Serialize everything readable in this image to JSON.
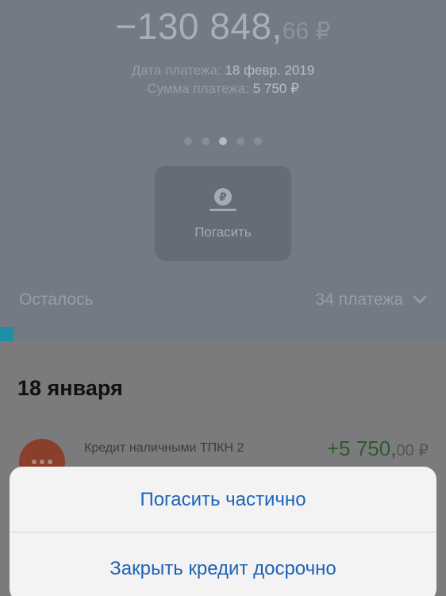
{
  "balance": {
    "integer": "−130 848,",
    "kopecks": "66 ₽"
  },
  "payment_info": {
    "date_label": "Дата платежа:",
    "date_value": "18 февр. 2019",
    "sum_label": "Сумма платежа:",
    "sum_value": "5 750 ₽"
  },
  "pager": {
    "count": 5,
    "active_index": 2
  },
  "pay_button": {
    "icon": "ruble-coin-icon",
    "label": "Погасить"
  },
  "remaining": {
    "label": "Осталось",
    "count": "34 платежа",
    "icon": "chevron-down-icon"
  },
  "progress_fraction": 0.03,
  "history": {
    "date_header": "18 января",
    "transaction": {
      "name": "Кредит наличными ТПКН 2",
      "amount_integer": "+5 750,",
      "amount_kopecks": "00 ₽"
    }
  },
  "action_sheet": {
    "items": [
      {
        "label": "Погасить частично"
      },
      {
        "label": "Закрыть кредит досрочно"
      }
    ]
  }
}
